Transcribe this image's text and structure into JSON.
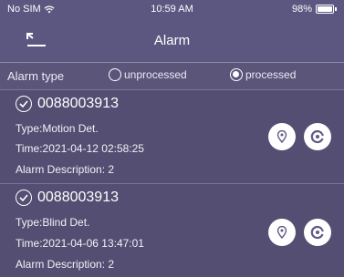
{
  "status_bar": {
    "carrier": "No SIM",
    "time": "10:59 AM",
    "battery": "98%"
  },
  "nav": {
    "title": "Alarm"
  },
  "filter": {
    "label": "Alarm type",
    "options": [
      {
        "label": "unprocessed",
        "selected": false
      },
      {
        "label": "processed",
        "selected": true
      }
    ]
  },
  "alarms": [
    {
      "device_id": "0088003913",
      "type": "Type:Motion Det.",
      "time": "Time:2021-04-12 02:58:25",
      "description": "Alarm Description:  2"
    },
    {
      "device_id": "0088003913",
      "type": "Type:Blind Det.",
      "time": "Time:2021-04-06 13:47:01",
      "description": "Alarm Description:  2"
    }
  ],
  "colors": {
    "background": "#5a5578",
    "card": "#534e72",
    "button_icon": "#5e5985"
  },
  "icons": [
    "wifi-icon",
    "battery-icon",
    "back-icon",
    "check-icon",
    "location-pin-icon",
    "processing-icon"
  ]
}
